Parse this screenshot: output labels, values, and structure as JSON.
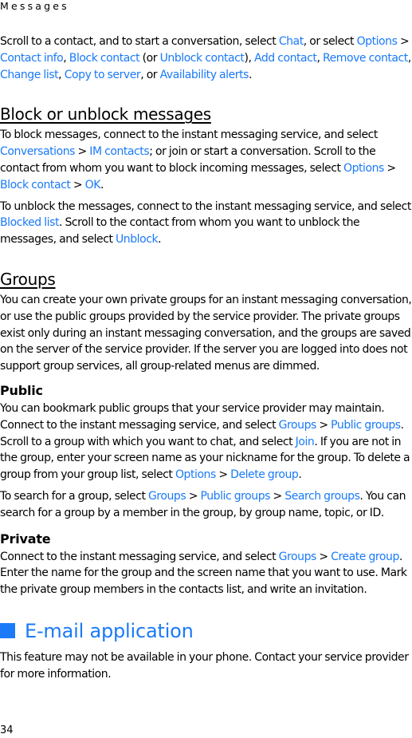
{
  "running_head": "Messages",
  "page_number": "34",
  "intro": {
    "t0": "Scroll to a contact, and to start a conversation, select ",
    "l0": "Chat",
    "t1": ", or select ",
    "l1": "Options",
    "t2": " > ",
    "l2": "Contact info",
    "t3": ", ",
    "l3": "Block contact",
    "t4": " (or ",
    "l4": "Unblock contact",
    "t5": "), ",
    "l5": "Add contact",
    "t6": ", ",
    "l6": "Remove contact",
    "t7": ", ",
    "l7": "Change list",
    "t8": ", ",
    "l8": "Copy to server",
    "t9": ", or ",
    "l9": "Availability alerts",
    "t10": "."
  },
  "block_section": {
    "heading": "Block or unblock messages",
    "p1": {
      "t0": "To block messages, connect to the instant messaging service, and select ",
      "l0": "Conversations",
      "t1": " > ",
      "l1": "IM contacts",
      "t2": "; or join or start a conversation. Scroll to the contact from whom you want to block incoming messages, select ",
      "l2": "Options",
      "t3": " > ",
      "l3": "Block contact",
      "t4": " > ",
      "l4": "OK",
      "t5": "."
    },
    "p2": {
      "t0": "To unblock the messages, connect to the instant messaging service, and select ",
      "l0": "Blocked list",
      "t1": ". Scroll to the contact from whom you want to unblock the messages, and select ",
      "l1": "Unblock",
      "t2": "."
    }
  },
  "groups_section": {
    "heading": "Groups",
    "p1": "You can create your own private groups for an instant messaging conversation, or use the public groups provided by the service provider. The private groups exist only during an instant messaging conversation, and the groups are saved on the server of the service provider. If the server you are logged into does not support group services, all group-related menus are dimmed.",
    "public": {
      "heading": "Public",
      "p1": {
        "t0": "You can bookmark public groups that your service provider may maintain. Connect to the instant messaging service, and select ",
        "l0": "Groups",
        "t1": " > ",
        "l1": "Public groups",
        "t2": ". Scroll to a group with which you want to chat, and select ",
        "l2": "Join",
        "t3": ". If you are not in the group, enter your screen name as your nickname for the group. To delete a group from your group list, select ",
        "l3": "Options",
        "t4": " > ",
        "l4": "Delete group",
        "t5": "."
      },
      "p2": {
        "t0": "To search for a group, select ",
        "l0": "Groups",
        "t1": " > ",
        "l1": "Public groups",
        "t2": " > ",
        "l2": "Search groups",
        "t3": ". You can search for a group by a member in the group, by group name, topic, or ID."
      }
    },
    "private": {
      "heading": "Private",
      "p1": {
        "t0": "Connect to the instant messaging service, and select ",
        "l0": "Groups",
        "t1": " > ",
        "l1": "Create group",
        "t2": ". Enter the name for the group and the screen name that you want to use. Mark the private group members in the contacts list, and write an invitation."
      }
    }
  },
  "email_section": {
    "heading": "E-mail application",
    "icon": "blue-square-bullet",
    "p1": "This feature may not be available in your phone. Contact your service provider for more information."
  },
  "colors": {
    "accent": "#1a7af8",
    "text": "#000000"
  }
}
